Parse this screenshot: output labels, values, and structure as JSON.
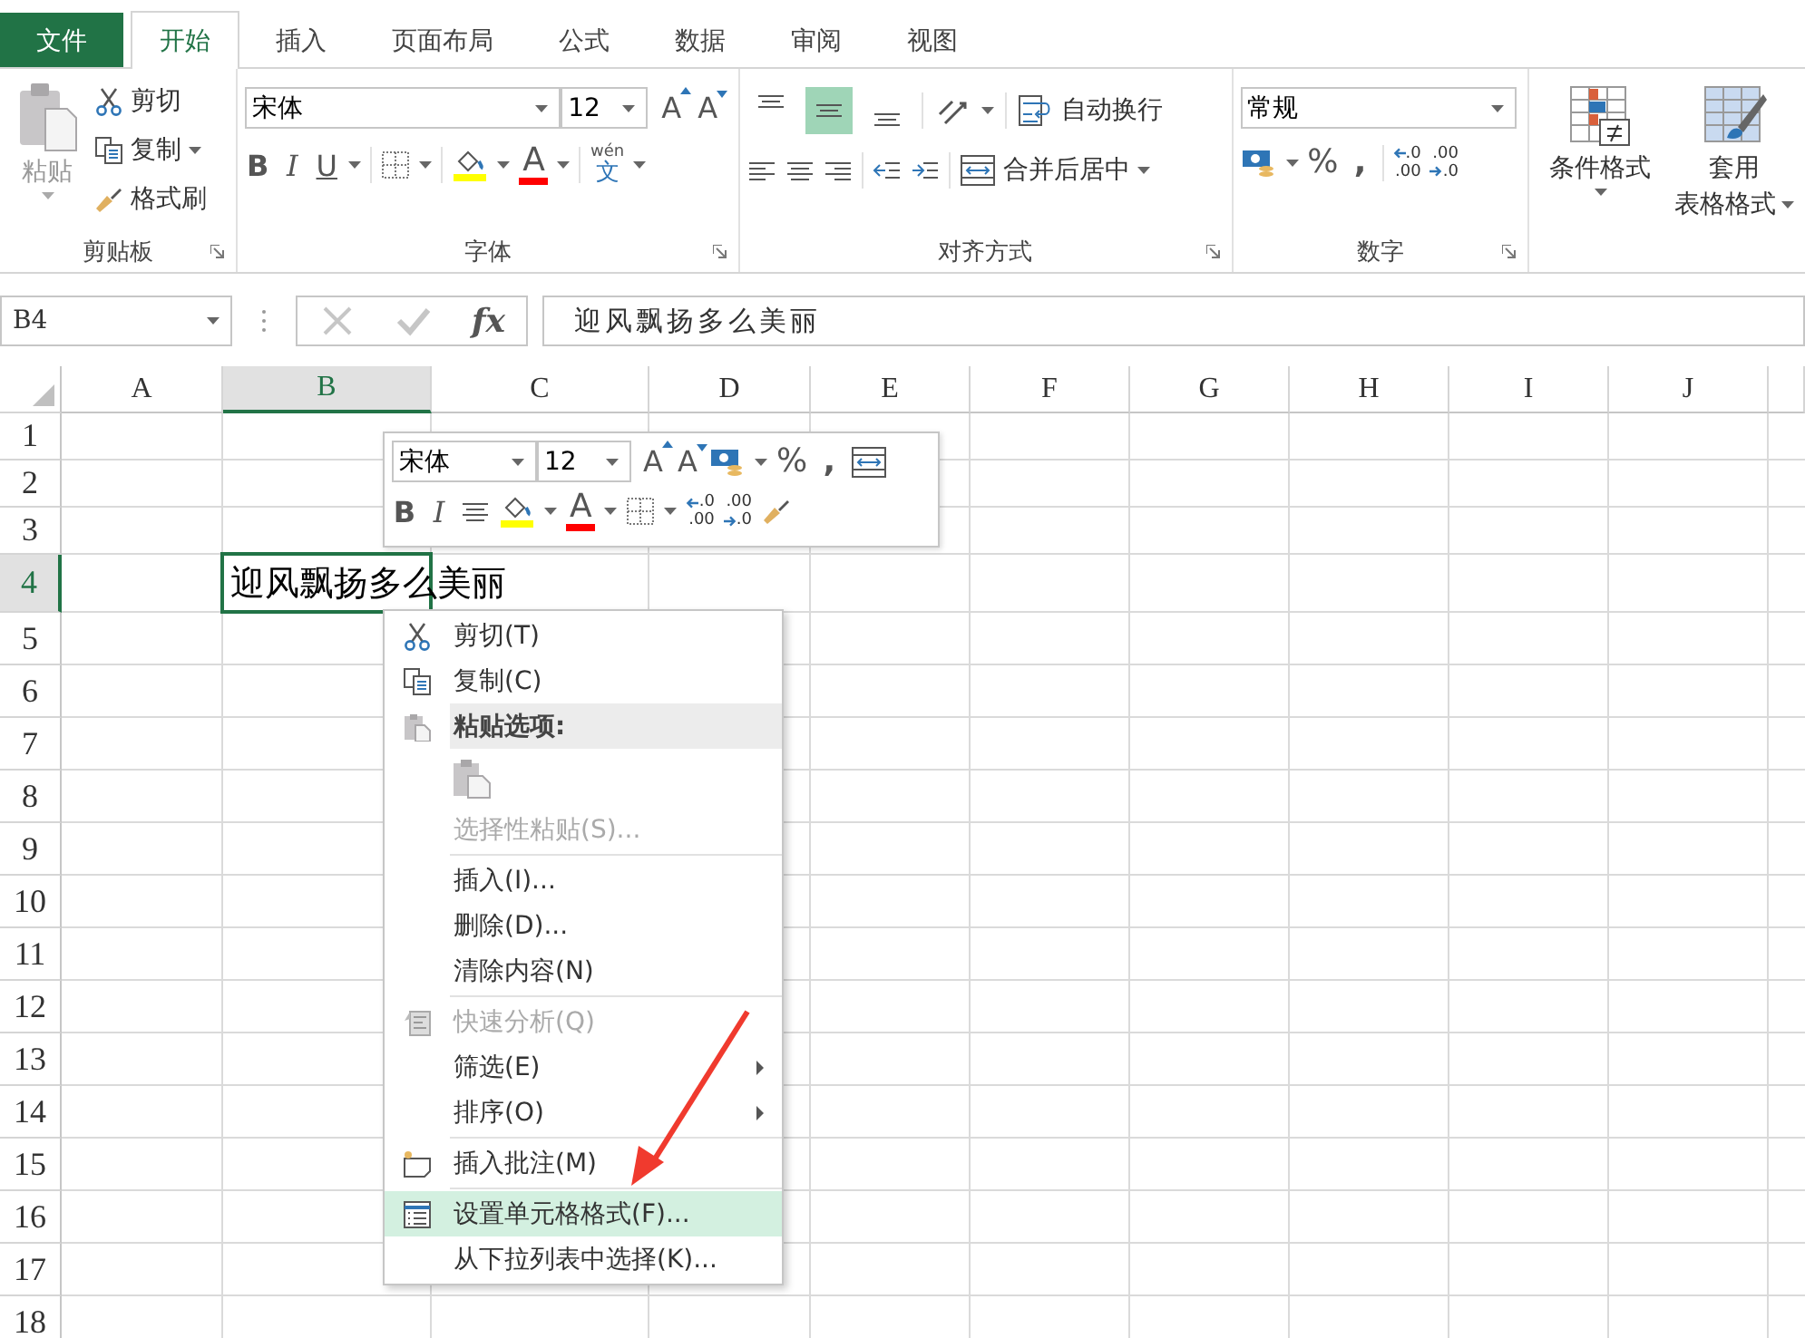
{
  "tabs": [
    {
      "label": "文件",
      "kind": "file",
      "selected": false
    },
    {
      "label": "开始",
      "kind": "tab",
      "selected": true
    },
    {
      "label": "插入",
      "kind": "tab",
      "selected": false
    },
    {
      "label": "页面布局",
      "kind": "tab",
      "selected": false
    },
    {
      "label": "公式",
      "kind": "tab",
      "selected": false
    },
    {
      "label": "数据",
      "kind": "tab",
      "selected": false
    },
    {
      "label": "审阅",
      "kind": "tab",
      "selected": false
    },
    {
      "label": "视图",
      "kind": "tab",
      "selected": false
    }
  ],
  "clipboard": {
    "paste": "粘贴",
    "cut": "剪切",
    "copy": "复制",
    "format_painter": "格式刷",
    "caption": "剪贴板"
  },
  "font": {
    "name": "宋体",
    "size": "12",
    "grow": "A",
    "shrink": "A",
    "bold": "B",
    "italic": "I",
    "underline": "U",
    "font_color": "A",
    "phonetic": "wén",
    "phonetic_char": "文",
    "caption": "字体"
  },
  "alignment": {
    "vertical": [
      {
        "selected": false
      },
      {
        "selected": true
      },
      {
        "selected": false
      }
    ],
    "wrap": "自动换行",
    "merge": "合并后居中",
    "caption": "对齐方式"
  },
  "number": {
    "format": "常规",
    "percent": "%",
    "comma": ",",
    "increase_decimal": [
      ".0",
      ".00"
    ],
    "decrease_decimal": [
      ".00",
      ".0"
    ],
    "caption": "数字"
  },
  "styles": {
    "conditional": "条件格式",
    "table_format": [
      "套用",
      "表格格式"
    ]
  },
  "formula_bar": {
    "name_box": "B4",
    "fx": "fx",
    "formula": "迎风飘扬多么美丽"
  },
  "sheet": {
    "columns": [
      {
        "label": "A",
        "selected": false
      },
      {
        "label": "B",
        "selected": true
      },
      {
        "label": "C",
        "selected": false
      },
      {
        "label": "D",
        "selected": false
      },
      {
        "label": "E",
        "selected": false
      },
      {
        "label": "F",
        "selected": false
      },
      {
        "label": "G",
        "selected": false
      },
      {
        "label": "H",
        "selected": false
      },
      {
        "label": "I",
        "selected": false
      },
      {
        "label": "J",
        "selected": false
      }
    ],
    "rows": [
      {
        "label": "1",
        "selected": false
      },
      {
        "label": "2",
        "selected": false
      },
      {
        "label": "3",
        "selected": false
      },
      {
        "label": "4",
        "selected": true
      },
      {
        "label": "5",
        "selected": false
      },
      {
        "label": "6",
        "selected": false
      },
      {
        "label": "7",
        "selected": false
      },
      {
        "label": "8",
        "selected": false
      },
      {
        "label": "9",
        "selected": false
      },
      {
        "label": "10",
        "selected": false
      },
      {
        "label": "11",
        "selected": false
      },
      {
        "label": "12",
        "selected": false
      },
      {
        "label": "13",
        "selected": false
      },
      {
        "label": "14",
        "selected": false
      },
      {
        "label": "15",
        "selected": false
      },
      {
        "label": "16",
        "selected": false
      },
      {
        "label": "17",
        "selected": false
      },
      {
        "label": "18",
        "selected": false
      }
    ],
    "active_cell": "迎风飘扬多么美丽"
  },
  "mini_toolbar": {
    "font_name": "宋体",
    "font_size": "12",
    "grow": "A",
    "shrink": "A",
    "percent": "%",
    "comma": ",",
    "bold": "B",
    "italic": "I",
    "font_color": "A",
    "increase_decimal": [
      ".0",
      ".00"
    ],
    "decrease_decimal": [
      ".00",
      ".0"
    ]
  },
  "context_menu": {
    "items": [
      {
        "kind": "item",
        "label": "剪切(T)",
        "disabled": false,
        "submenu": false,
        "selected": false
      },
      {
        "kind": "item",
        "label": "复制(C)",
        "disabled": false,
        "submenu": false,
        "selected": false
      },
      {
        "kind": "header",
        "label": "粘贴选项:"
      },
      {
        "kind": "paste-options"
      },
      {
        "kind": "item",
        "label": "选择性粘贴(S)...",
        "disabled": true,
        "submenu": false,
        "selected": false
      },
      {
        "kind": "separator"
      },
      {
        "kind": "item",
        "label": "插入(I)...",
        "disabled": false,
        "submenu": false,
        "selected": false
      },
      {
        "kind": "item",
        "label": "删除(D)...",
        "disabled": false,
        "submenu": false,
        "selected": false
      },
      {
        "kind": "item",
        "label": "清除内容(N)",
        "disabled": false,
        "submenu": false,
        "selected": false
      },
      {
        "kind": "separator"
      },
      {
        "kind": "item",
        "label": "快速分析(Q)",
        "disabled": true,
        "submenu": false,
        "selected": false
      },
      {
        "kind": "item",
        "label": "筛选(E)",
        "disabled": false,
        "submenu": true,
        "selected": false
      },
      {
        "kind": "item",
        "label": "排序(O)",
        "disabled": false,
        "submenu": true,
        "selected": false
      },
      {
        "kind": "separator"
      },
      {
        "kind": "item",
        "label": "插入批注(M)",
        "disabled": false,
        "submenu": false,
        "selected": false
      },
      {
        "kind": "separator"
      },
      {
        "kind": "item",
        "label": "设置单元格格式(F)...",
        "disabled": false,
        "submenu": false,
        "selected": true
      },
      {
        "kind": "item",
        "label": "从下拉列表中选择(K)...",
        "disabled": false,
        "submenu": false,
        "selected": false
      }
    ]
  }
}
